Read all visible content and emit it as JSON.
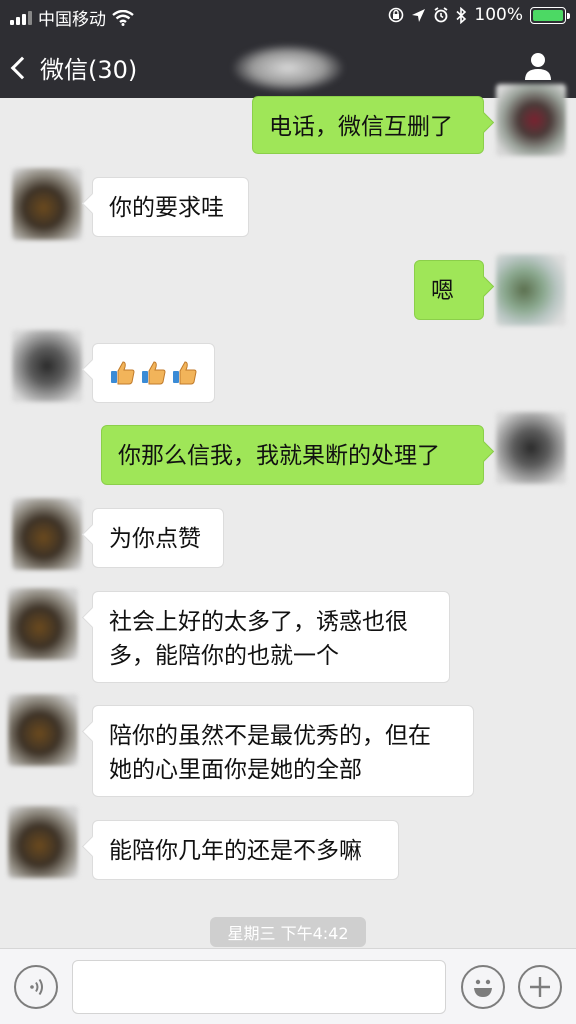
{
  "status_bar": {
    "carrier": "中国移动",
    "battery_percent": "100%",
    "battery_level": 1.0
  },
  "nav": {
    "back_label": "微信(30)",
    "icons": [
      "chevron-left-icon",
      "profile-icon"
    ]
  },
  "messages": [
    {
      "side": "right",
      "text": "电话，微信互删了"
    },
    {
      "side": "left",
      "text": "你的要求哇"
    },
    {
      "side": "right",
      "text": "嗯"
    },
    {
      "side": "left",
      "emoji": "thumbs-up x3"
    },
    {
      "side": "right",
      "text": "你那么信我，我就果断的处理了"
    },
    {
      "side": "left",
      "text": "为你点赞"
    },
    {
      "side": "left",
      "lines": [
        "社会上好的太多了，诱惑也很",
        "多，能陪你的也就一个"
      ]
    },
    {
      "side": "left",
      "lines": [
        "陪你的虽然不是最优秀的，但在",
        "她的心里面你是她的全部"
      ]
    },
    {
      "side": "left",
      "text": "能陪你几年的还是不多嘛"
    }
  ],
  "timestamp": "星期三 下午4:42",
  "input_bar": {
    "text_value": "",
    "icons": [
      "voice-icon",
      "emoji-icon",
      "plus-icon"
    ]
  },
  "colors": {
    "nav_bg": "#2e2e33",
    "chat_bg": "#ebebeb",
    "bubble_self": "#9fe658",
    "bubble_other": "#ffffff"
  }
}
